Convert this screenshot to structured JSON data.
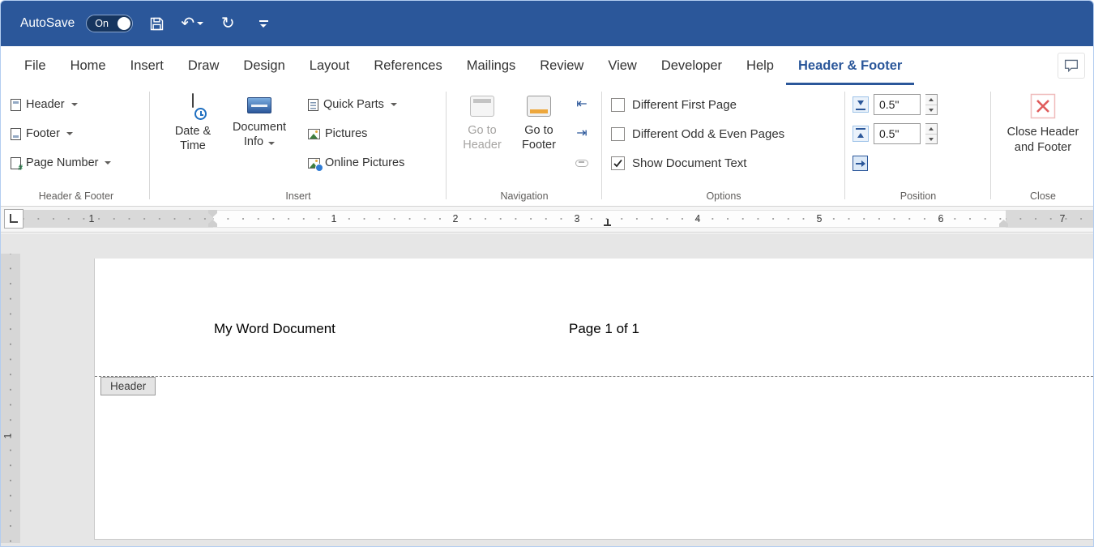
{
  "titlebar": {
    "autosave_label": "AutoSave",
    "autosave_state": "On"
  },
  "tabs": [
    "File",
    "Home",
    "Insert",
    "Draw",
    "Design",
    "Layout",
    "References",
    "Mailings",
    "Review",
    "View",
    "Developer",
    "Help",
    "Header & Footer"
  ],
  "ribbon": {
    "header_footer_group": {
      "label": "Header & Footer",
      "header": "Header",
      "footer": "Footer",
      "page_number": "Page Number"
    },
    "insert_group": {
      "label": "Insert",
      "date_time": "Date & Time",
      "document_info": "Document Info",
      "quick_parts": "Quick Parts",
      "pictures": "Pictures",
      "online_pictures": "Online Pictures"
    },
    "navigation_group": {
      "label": "Navigation",
      "go_to_header": "Go to Header",
      "go_to_footer": "Go to Footer"
    },
    "options_group": {
      "label": "Options",
      "different_first_page": "Different First Page",
      "different_odd_even": "Different Odd & Even Pages",
      "show_document_text": "Show Document Text",
      "show_document_text_checked": true
    },
    "position_group": {
      "label": "Position",
      "header_from_top_value": "0.5\"",
      "footer_from_bottom_value": "0.5\""
    },
    "close_group": {
      "label": "Close",
      "close_button": "Close Header and Footer"
    }
  },
  "ruler": {
    "h_marks": [
      "1",
      "1",
      "2",
      "3",
      "4",
      "5",
      "6",
      "7"
    ],
    "v_marks": [
      "1"
    ]
  },
  "document": {
    "header_left_text": "My Word Document",
    "header_center_text": "Page 1 of 1",
    "header_tag_label": "Header"
  },
  "colors": {
    "accent": "#2b579a",
    "close_red": "#e05c5c",
    "highlight_orange": "#eda73c"
  }
}
